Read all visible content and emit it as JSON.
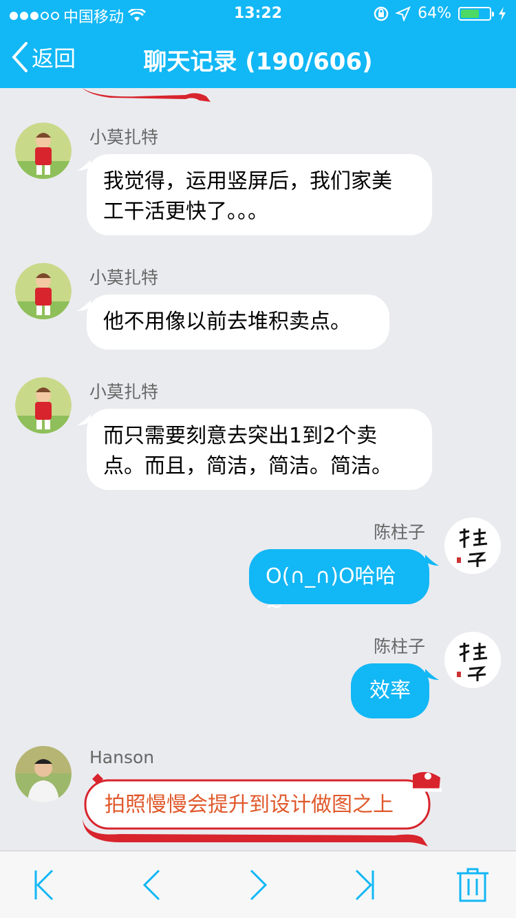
{
  "status_bar": {
    "carrier": "中国移动",
    "time": "13:22",
    "battery": "64%",
    "battery_level": 0.64,
    "signal_bars": 3
  },
  "nav": {
    "back_label": "返回",
    "title": "聊天记录 (190/606)"
  },
  "messages": [
    {
      "sender": "小莫扎特",
      "direction": "in",
      "lines": [
        "我觉得，运用竖屏后，我们家美",
        "工干活更快了。。。"
      ]
    },
    {
      "sender": "小莫扎特",
      "direction": "in",
      "lines": [
        "他不用像以前去堆积卖点。"
      ]
    },
    {
      "sender": "小莫扎特",
      "direction": "in",
      "lines": [
        "而只需要刻意去突出1到2个卖",
        "点。而且，简洁，简洁。简洁。"
      ]
    },
    {
      "sender": "陈柱子",
      "direction": "out",
      "lines": [
        "O(∩_∩)O哈哈~"
      ]
    },
    {
      "sender": "陈柱子",
      "direction": "out",
      "lines": [
        "效率"
      ]
    },
    {
      "sender": "Hanson",
      "direction": "in",
      "style": "festive",
      "lines": [
        "拍照慢慢会提升到设计做图之上"
      ]
    }
  ],
  "toolbar": {
    "first_icon": "skip-to-first-icon",
    "prev_icon": "chevron-left-icon",
    "next_icon": "chevron-right-icon",
    "last_icon": "skip-to-last-icon",
    "delete_icon": "trash-icon"
  },
  "colors": {
    "accent": "#12b7f5",
    "chat_bg": "#eaebef",
    "festive_red": "#d8242d",
    "festive_text": "#e0582a"
  }
}
